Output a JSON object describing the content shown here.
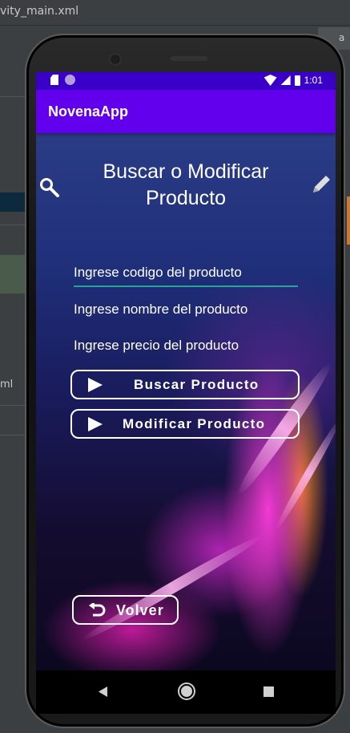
{
  "ide": {
    "tab_label": "vity_main.xml",
    "side_label": "ml"
  },
  "statusbar": {
    "time": "1:01"
  },
  "appbar": {
    "title": "NovenaApp"
  },
  "page": {
    "title": "Buscar o Modificar Producto",
    "search_icon": "search-icon",
    "edit_icon": "pencil-icon"
  },
  "form": {
    "codigo_placeholder": "Ingrese codigo del producto",
    "nombre_placeholder": "Ingrese nombre del producto",
    "precio_placeholder": "Ingrese precio del producto"
  },
  "buttons": {
    "buscar_label": "Buscar Producto",
    "modificar_label": "Modificar Producto",
    "volver_label": "Volver"
  },
  "colors": {
    "statusbar": "#3a00c9",
    "appbar": "#6200ee",
    "focus_underline": "#26a69a"
  }
}
